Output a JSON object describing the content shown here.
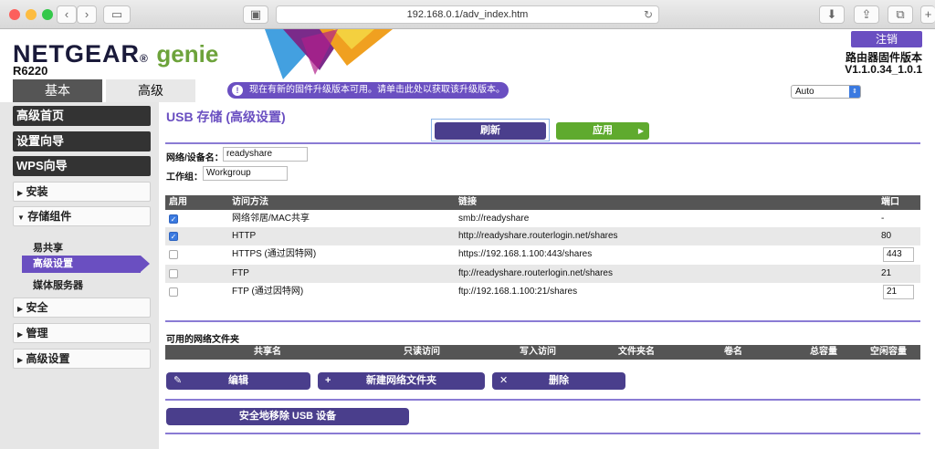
{
  "browser": {
    "url": "192.168.0.1/adv_index.htm"
  },
  "header": {
    "brand": "NETGEAR",
    "brand_suffix": "genie",
    "model": "R6220",
    "logout": "注销",
    "fw_label": "路由器固件版本",
    "fw_version": "V1.1.0.34_1.0.1",
    "tabs": [
      {
        "label": "基本"
      },
      {
        "label": "高级"
      }
    ],
    "notice": "现在有新的固件升级版本可用。请单击此处以获取该升级版本。",
    "language": "Auto"
  },
  "sidebar": {
    "items": [
      {
        "label": "高级首页"
      },
      {
        "label": "设置向导"
      },
      {
        "label": "WPS向导"
      },
      {
        "label": "安装"
      },
      {
        "label": "存储组件"
      },
      {
        "label": "安全"
      },
      {
        "label": "管理"
      },
      {
        "label": "高级设置"
      }
    ],
    "sub": [
      {
        "label": "易共享"
      },
      {
        "label": "高级设置"
      },
      {
        "label": "媒体服务器"
      }
    ]
  },
  "main": {
    "title": "USB 存储 (高级设置)",
    "refresh": "刷新",
    "apply": "应用",
    "device_name_label": "网络/设备名：",
    "device_name": "readyshare",
    "workgroup_label": "工作组：",
    "workgroup": "Workgroup",
    "columns": {
      "enable": "启用",
      "method": "访问方法",
      "link": "链接",
      "port": "端口"
    },
    "rows": [
      {
        "checked": true,
        "method": "网络邻居/MAC共享",
        "link": "smb://readyshare",
        "port": "-"
      },
      {
        "checked": true,
        "method": "HTTP",
        "link": "http://readyshare.routerlogin.net/shares",
        "port": "80"
      },
      {
        "checked": false,
        "method": "HTTPS (通过因特网)",
        "link": "https://192.168.1.100:443/shares",
        "port": "443"
      },
      {
        "checked": false,
        "method": "FTP",
        "link": "ftp://readyshare.routerlogin.net/shares",
        "port": "21"
      },
      {
        "checked": false,
        "method": "FTP (通过因特网)",
        "link": "ftp://192.168.1.100:21/shares",
        "port": "21"
      }
    ],
    "folders_title": "可用的网络文件夹",
    "folder_columns": [
      "共享名",
      "只读访问",
      "写入访问",
      "文件夹名",
      "卷名",
      "总容量",
      "空闲容量"
    ],
    "edit": "编辑",
    "new_folder": "新建网络文件夹",
    "delete": "删除",
    "safe_remove": "安全地移除 USB 设备"
  },
  "colors": {
    "accent": "#6a4fc1",
    "apply": "#5faa2e",
    "button_dark": "#4a3e8c"
  }
}
